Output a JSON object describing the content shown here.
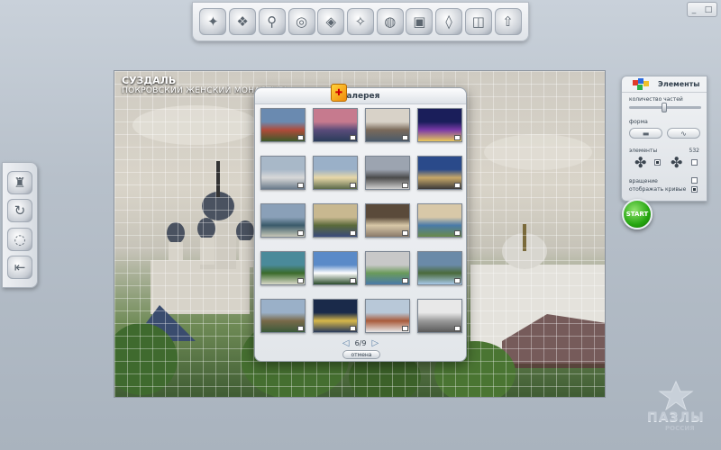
{
  "window": {
    "controls": [
      "_",
      "□"
    ]
  },
  "top_toolbar": {
    "items": [
      {
        "name": "scatter-icon",
        "glyph": "✦"
      },
      {
        "name": "stack-icon",
        "glyph": "❖"
      },
      {
        "name": "pin-icon",
        "glyph": "⚲"
      },
      {
        "name": "disc-icon",
        "glyph": "◎"
      },
      {
        "name": "box-icon",
        "glyph": "◈"
      },
      {
        "name": "tool-icon",
        "glyph": "✧"
      },
      {
        "name": "globe-icon",
        "glyph": "◍"
      },
      {
        "name": "bag-icon",
        "glyph": "▣"
      },
      {
        "name": "cup-icon",
        "glyph": "◊"
      },
      {
        "name": "photo-icon",
        "glyph": "◫"
      },
      {
        "name": "upload-icon",
        "glyph": "⇧"
      }
    ]
  },
  "left_toolbar": {
    "items": [
      {
        "name": "figure-icon",
        "glyph": "♜"
      },
      {
        "name": "rotate-icon",
        "glyph": "↻"
      },
      {
        "name": "ring-icon",
        "glyph": "◌"
      },
      {
        "name": "back-arrow-icon",
        "glyph": "⇤"
      }
    ]
  },
  "board": {
    "title": "СУЗДАЛЬ",
    "subtitle": "ПОКРОВСКИЙ ЖЕНСКИЙ МОНАСТЫРЬ"
  },
  "gallery": {
    "title": "Галерея",
    "page": "6/9",
    "cancel_label": "отмена",
    "thumbnails": [
      {
        "colors": [
          "#6a8ab0",
          "#b04a3a",
          "#3c5a2a"
        ]
      },
      {
        "colors": [
          "#c67a8e",
          "#5a4c7a",
          "#2a3c5a"
        ]
      },
      {
        "colors": [
          "#d8d2c8",
          "#7a6a5a",
          "#4a5a6a"
        ]
      },
      {
        "colors": [
          "#1a1e5a",
          "#7a3aa8",
          "#e8c85a"
        ]
      },
      {
        "colors": [
          "#a8b8c8",
          "#d8d8d8",
          "#6a7a8a"
        ]
      },
      {
        "colors": [
          "#9ab0c8",
          "#e8d8a8",
          "#5a6a4a"
        ]
      },
      {
        "colors": [
          "#9ca4b0",
          "#4a4a4a",
          "#d0d0d0"
        ]
      },
      {
        "colors": [
          "#2a4a8a",
          "#c8a868",
          "#3a3a3a"
        ]
      },
      {
        "colors": [
          "#8aa0b8",
          "#3a5a6a",
          "#c8c8b8"
        ]
      },
      {
        "colors": [
          "#c8b890",
          "#5a6a3a",
          "#3a4a7a"
        ]
      },
      {
        "colors": [
          "#5a4a3a",
          "#d8c8a8",
          "#8a7a6a"
        ]
      },
      {
        "colors": [
          "#d8c8a8",
          "#4a7aa8",
          "#6a8a4a"
        ]
      },
      {
        "colors": [
          "#4a8a9a",
          "#3a6a2a",
          "#d8d8c8"
        ]
      },
      {
        "colors": [
          "#5a8ac8",
          "#ffffff",
          "#2a4a2a"
        ]
      },
      {
        "colors": [
          "#c8c8c8",
          "#6a9a5a",
          "#4a7aa8"
        ]
      },
      {
        "colors": [
          "#6a8aa8",
          "#4a6a3a",
          "#a8c8e8"
        ]
      },
      {
        "colors": [
          "#9ab0c8",
          "#7a6a4a",
          "#3a5a3a"
        ]
      },
      {
        "colors": [
          "#1a2a4a",
          "#d8b84a",
          "#2a3a5a"
        ]
      },
      {
        "colors": [
          "#b8c8d8",
          "#a85a3a",
          "#e8e8e8"
        ]
      },
      {
        "colors": [
          "#e8e8e8",
          "#9a9a9a",
          "#5a5a5a"
        ]
      }
    ]
  },
  "elements_panel": {
    "title": "Элементы",
    "count_label": "количество частей",
    "shape_label": "форма",
    "pieces_label": "элементы",
    "pieces_count": "532",
    "rotation_label": "вращение",
    "curves_label": "отображать кривые",
    "start_label": "START"
  },
  "brand": {
    "name": "ПАЗЛЫ",
    "sub": "РОССИЯ"
  }
}
